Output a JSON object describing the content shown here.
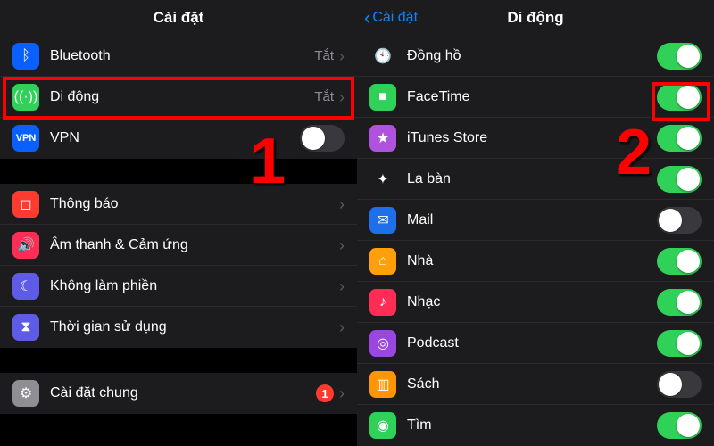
{
  "left": {
    "title": "Cài đặt",
    "rows": [
      {
        "icon": "bluetooth-icon",
        "bg": "#0a5fff",
        "label": "Bluetooth",
        "value": "Tắt",
        "type": "chevron"
      },
      {
        "icon": "cellular-icon",
        "bg": "#30d158",
        "label": "Di động",
        "value": "Tắt",
        "type": "chevron",
        "highlight": true
      },
      {
        "icon": "vpn-icon",
        "bg": "#0a5fff",
        "label": "VPN",
        "type": "toggle",
        "on": false
      }
    ],
    "rows2": [
      {
        "icon": "notifications-icon",
        "bg": "#ff3b30",
        "label": "Thông báo",
        "type": "chevron"
      },
      {
        "icon": "sound-icon",
        "bg": "#ff2d55",
        "label": "Âm thanh & Cảm ứng",
        "type": "chevron"
      },
      {
        "icon": "dnd-icon",
        "bg": "#5e5ce6",
        "label": "Không làm phiền",
        "type": "chevron"
      },
      {
        "icon": "screentime-icon",
        "bg": "#5e5ce6",
        "label": "Thời gian sử dụng",
        "type": "chevron"
      }
    ],
    "rows3": [
      {
        "icon": "general-icon",
        "bg": "#8e8e93",
        "label": "Cài đặt chung",
        "type": "chevron",
        "badge": "1"
      }
    ],
    "step": "1"
  },
  "right": {
    "back": "Cài đặt",
    "title": "Di động",
    "rows": [
      {
        "icon": "clock-icon",
        "bg": "#1c1c1e",
        "label": "Đồng hồ",
        "on": true
      },
      {
        "icon": "facetime-icon",
        "bg": "#30d158",
        "label": "FaceTime",
        "on": true,
        "highlight": true
      },
      {
        "icon": "itunes-icon",
        "bg": "#af52de",
        "label": "iTunes Store",
        "on": true
      },
      {
        "icon": "compass-icon",
        "bg": "#1c1c1e",
        "label": "La bàn",
        "on": true
      },
      {
        "icon": "mail-icon",
        "bg": "#1f6feb",
        "label": "Mail",
        "on": false
      },
      {
        "icon": "home-icon",
        "bg": "#ff9f0a",
        "label": "Nhà",
        "on": true
      },
      {
        "icon": "music-icon",
        "bg": "#ff2d55",
        "label": "Nhạc",
        "on": true
      },
      {
        "icon": "podcast-icon",
        "bg": "#9a46e0",
        "label": "Podcast",
        "on": true
      },
      {
        "icon": "books-icon",
        "bg": "#ff9500",
        "label": "Sách",
        "on": false
      },
      {
        "icon": "findmy-icon",
        "bg": "#30d158",
        "label": "Tìm",
        "on": true
      }
    ],
    "step": "2"
  }
}
